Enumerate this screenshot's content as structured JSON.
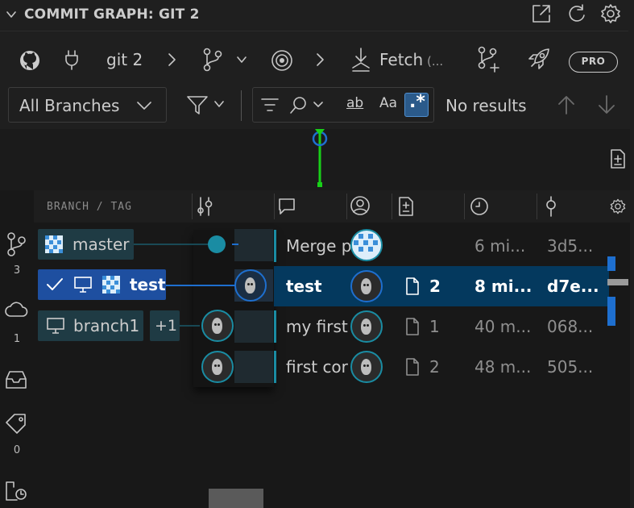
{
  "header": {
    "title": "COMMIT GRAPH: GIT 2",
    "icons": [
      "chevron-down-icon",
      "popout-icon",
      "refresh-icon",
      "gear-icon"
    ]
  },
  "toolbar": {
    "repo_name": "git 2",
    "fetch_label": "Fetch",
    "fetch_suffix": "(...",
    "pro_label": "PRO"
  },
  "filters": {
    "branch_select": "All Branches",
    "match_whole_word": "ab",
    "match_case": "Aa",
    "regex": ".*",
    "status": "No results"
  },
  "columns": {
    "branch_tag": "BRANCH / TAG"
  },
  "rail": {
    "counts": [
      "3",
      "1",
      "0"
    ]
  },
  "refs": [
    {
      "name": "master"
    },
    {
      "name": "test"
    },
    {
      "name": "branch1",
      "extra": "+1"
    }
  ],
  "commits": [
    {
      "message": "Merge p",
      "files": "",
      "time": "6 mi...",
      "sha": "3d5..."
    },
    {
      "message": "test",
      "files": "2",
      "time": "8 mi...",
      "sha": "d7e..."
    },
    {
      "message": "my first",
      "files": "1",
      "time": "40 m...",
      "sha": "068..."
    },
    {
      "message": "first cor",
      "files": "2",
      "time": "48 m...",
      "sha": "505..."
    }
  ],
  "colors": {
    "accent": "#1e4fa0",
    "selected_row": "#04395e",
    "graph_line": "#1a8ca3",
    "minimap_line": "#18d018"
  }
}
